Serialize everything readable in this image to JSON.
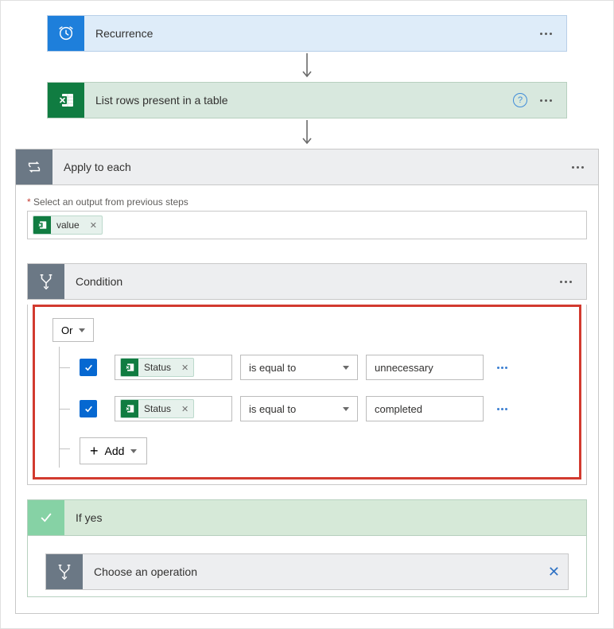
{
  "recurrence": {
    "title": "Recurrence"
  },
  "excel": {
    "title": "List rows present in a table"
  },
  "apply_each": {
    "title": "Apply to each",
    "hint_label": "Select an output from previous steps",
    "token_label": "value"
  },
  "condition": {
    "title": "Condition",
    "logic_label": "Or",
    "rows": [
      {
        "field": "Status",
        "operator": "is equal to",
        "value": "unnecessary"
      },
      {
        "field": "Status",
        "operator": "is equal to",
        "value": "completed"
      }
    ],
    "add_label": "Add"
  },
  "if_yes": {
    "title": "If yes"
  },
  "choose_op": {
    "title": "Choose an operation"
  }
}
